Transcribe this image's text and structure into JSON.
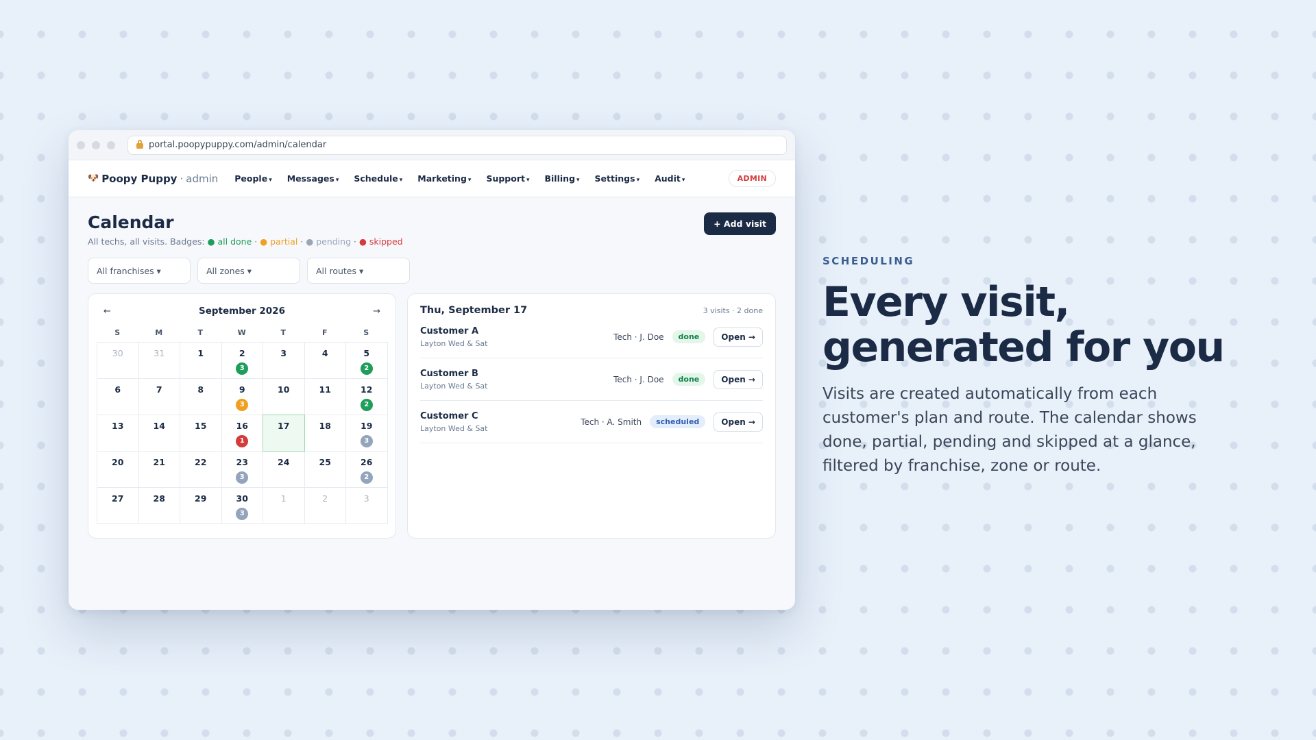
{
  "browser": {
    "url": "portal.poopypuppy.com/admin/calendar"
  },
  "nav": {
    "brand_icon": "🐶",
    "brand_name": "Poopy Puppy",
    "brand_sep": "·",
    "brand_role": "admin",
    "menu": [
      "People",
      "Messages",
      "Schedule",
      "Marketing",
      "Support",
      "Billing",
      "Settings",
      "Audit"
    ],
    "caret": "▾",
    "role_pill": "ADMIN"
  },
  "page": {
    "title": "Calendar",
    "subtitle_prefix": "All techs, all visits. Badges:",
    "legend": {
      "done": "● all done",
      "partial": "● partial",
      "pending": "● pending",
      "skipped": "● skipped",
      "sep": "·"
    },
    "add_button": "+ Add visit"
  },
  "filters": {
    "franchise": "All franchises ▾",
    "zone": "All zones ▾",
    "route": "All routes ▾"
  },
  "calendar": {
    "prev": "←",
    "next": "→",
    "month": "September 2026",
    "weekdays": [
      "S",
      "M",
      "T",
      "W",
      "T",
      "F",
      "S"
    ],
    "days": [
      {
        "d": "30",
        "muted": true
      },
      {
        "d": "31",
        "muted": true
      },
      {
        "d": "1"
      },
      {
        "d": "2",
        "badge": "3",
        "status": "done"
      },
      {
        "d": "3"
      },
      {
        "d": "4"
      },
      {
        "d": "5",
        "badge": "2",
        "status": "done"
      },
      {
        "d": "6"
      },
      {
        "d": "7"
      },
      {
        "d": "8"
      },
      {
        "d": "9",
        "badge": "3",
        "status": "partial"
      },
      {
        "d": "10"
      },
      {
        "d": "11"
      },
      {
        "d": "12",
        "badge": "2",
        "status": "done"
      },
      {
        "d": "13"
      },
      {
        "d": "14"
      },
      {
        "d": "15"
      },
      {
        "d": "16",
        "badge": "1",
        "status": "skipped"
      },
      {
        "d": "17",
        "today": true
      },
      {
        "d": "18"
      },
      {
        "d": "19",
        "badge": "3",
        "status": "pending"
      },
      {
        "d": "20"
      },
      {
        "d": "21"
      },
      {
        "d": "22"
      },
      {
        "d": "23",
        "badge": "3",
        "status": "pending"
      },
      {
        "d": "24"
      },
      {
        "d": "25"
      },
      {
        "d": "26",
        "badge": "2",
        "status": "pending"
      },
      {
        "d": "27"
      },
      {
        "d": "28"
      },
      {
        "d": "29"
      },
      {
        "d": "30",
        "badge": "3",
        "status": "pending"
      },
      {
        "d": "1",
        "muted": true
      },
      {
        "d": "2",
        "muted": true
      },
      {
        "d": "3",
        "muted": true
      }
    ]
  },
  "day": {
    "title": "Thu, September 17",
    "summary": "3 visits · 2 done",
    "open_label": "Open →",
    "visits": [
      {
        "name": "Customer A",
        "route": "Layton Wed & Sat",
        "tech": "Tech · J. Doe",
        "status": "done"
      },
      {
        "name": "Customer B",
        "route": "Layton Wed & Sat",
        "tech": "Tech · J. Doe",
        "status": "done"
      },
      {
        "name": "Customer C",
        "route": "Layton Wed & Sat",
        "tech": "Tech · A. Smith",
        "status": "scheduled"
      }
    ]
  },
  "hero": {
    "eyebrow": "SCHEDULING",
    "title_line1": "Every visit,",
    "title_line2": "generated for you",
    "body": "Visits are created automatically from each customer's plan and route. The calendar shows done, partial, pending and skipped at a glance, filtered by franchise, zone or route."
  },
  "colors": {
    "done": "#1e9d5b",
    "partial": "#f0a020",
    "pending": "#93a4bd",
    "skipped": "#d43b3b",
    "navy": "#1c2b45"
  }
}
